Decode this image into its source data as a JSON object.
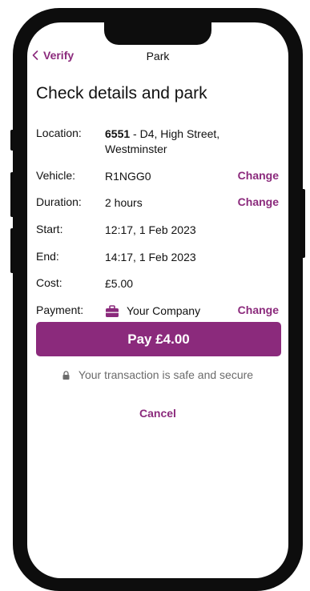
{
  "nav": {
    "back_label": "Verify",
    "title": "Park"
  },
  "heading": "Check details and park",
  "details": {
    "location": {
      "label": "Location:",
      "code": "6551",
      "text": " - D4, High Street,",
      "text2": "Westminster"
    },
    "vehicle": {
      "label": "Vehicle:",
      "value": "R1NGG0",
      "action": "Change"
    },
    "duration": {
      "label": "Duration:",
      "value": "2 hours",
      "action": "Change"
    },
    "start": {
      "label": "Start:",
      "value": "12:17, 1 Feb 2023"
    },
    "end": {
      "label": "End:",
      "value": "14:17, 1 Feb 2023"
    },
    "cost": {
      "label": "Cost:",
      "value": "£5.00"
    },
    "payment": {
      "label": "Payment:",
      "value": "Your Company",
      "icon": "briefcase-icon",
      "action": "Change"
    }
  },
  "pay_button": "Pay £4.00",
  "secure_text": "Your transaction is safe and secure",
  "cancel_label": "Cancel",
  "colors": {
    "accent": "#8b2a7c",
    "muted": "#6b6b6b",
    "frame": "#0d0d0d"
  }
}
